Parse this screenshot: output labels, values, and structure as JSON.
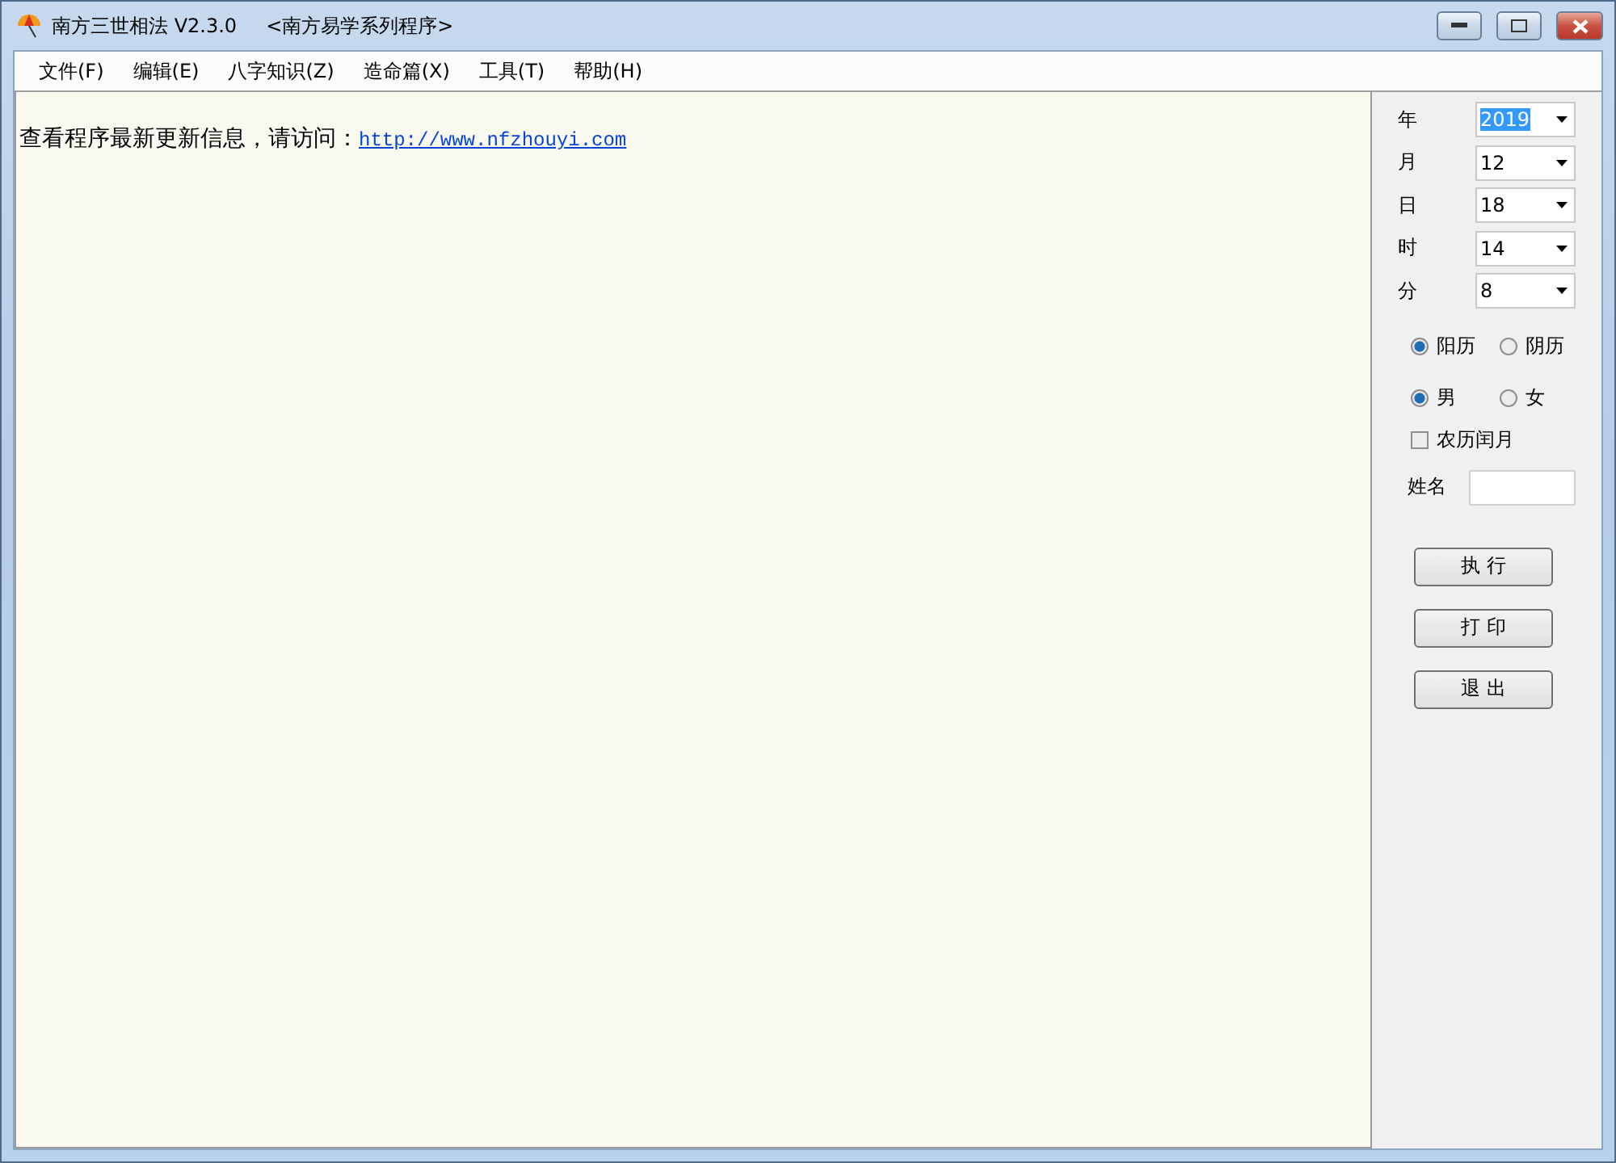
{
  "window": {
    "title": "南方三世相法 V2.3.0",
    "subtitle": "<南方易学系列程序>"
  },
  "menu": [
    "文件(F)",
    "编辑(E)",
    "八字知识(Z)",
    "造命篇(X)",
    "工具(T)",
    "帮助(H)"
  ],
  "content": {
    "text": "查看程序最新更新信息，请访问：",
    "link": "http://www.nfzhouyi.com"
  },
  "date_fields": [
    {
      "label": "年",
      "value": "2019",
      "focused": true
    },
    {
      "label": "月",
      "value": "12",
      "focused": false
    },
    {
      "label": "日",
      "value": "18",
      "focused": false
    },
    {
      "label": "时",
      "value": "14",
      "focused": false
    },
    {
      "label": "分",
      "value": "8",
      "focused": false
    }
  ],
  "calendar": [
    {
      "label": "阳历",
      "selected": true
    },
    {
      "label": "阴历",
      "selected": false
    }
  ],
  "gender": [
    {
      "label": "男",
      "selected": true
    },
    {
      "label": "女",
      "selected": false
    }
  ],
  "leap_month": {
    "label": "农历闰月",
    "checked": false
  },
  "name_field": {
    "label": "姓名"
  },
  "buttons": [
    "执 行",
    "打 印",
    "退 出"
  ]
}
